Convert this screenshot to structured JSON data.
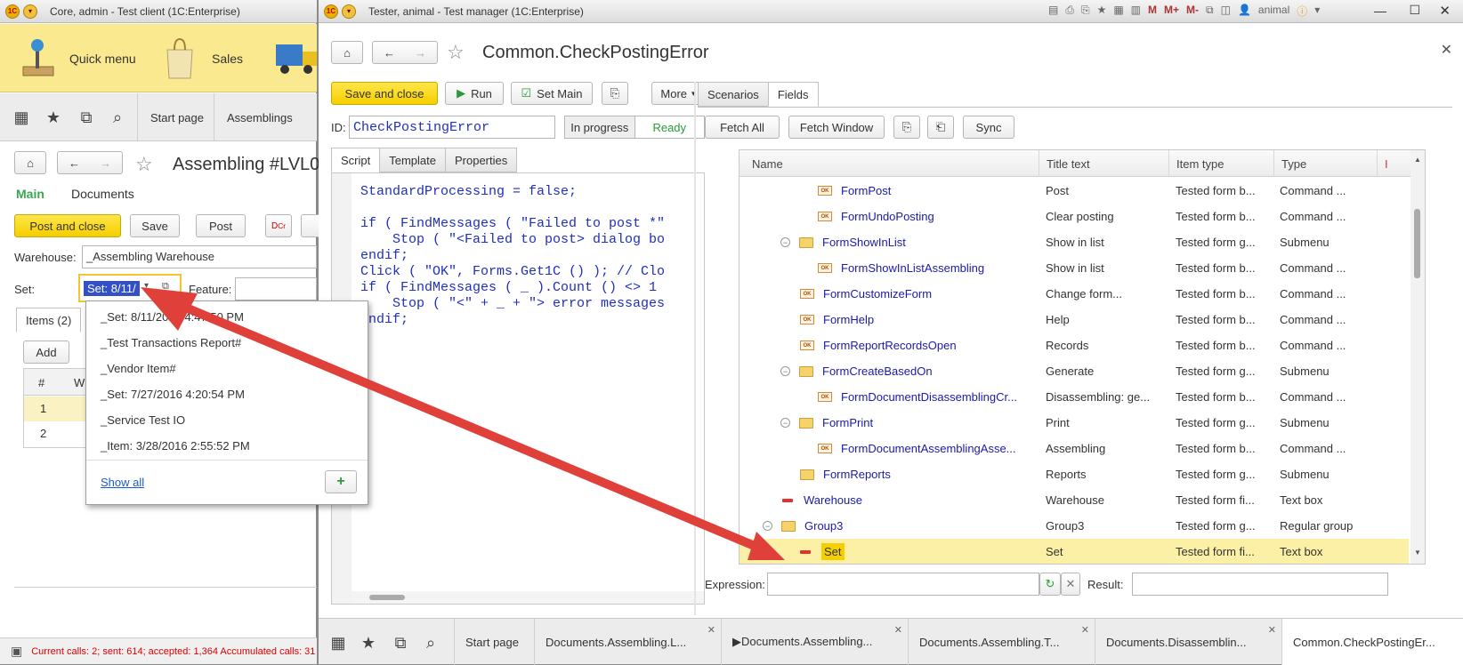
{
  "left_window": {
    "title": "Core, admin - Test client (1C:Enterprise)",
    "sections": [
      "Quick menu",
      "Sales"
    ],
    "nav_tabs": [
      "Start page",
      "Assemblings"
    ],
    "doc_title": "Assembling #LVL0",
    "subtabs": [
      "Main",
      "Documents"
    ],
    "buttons": {
      "post_close": "Post and close",
      "save": "Save",
      "post": "Post"
    },
    "warehouse_label": "Warehouse:",
    "warehouse_value": "_Assembling Warehouse",
    "set_label": "Set:",
    "set_value": "Set: 8/11/",
    "feature_label": "Feature:",
    "items_tab": "Items (2)",
    "add_button": "Add",
    "table_header": [
      "#",
      "W"
    ],
    "table_rows": [
      "1",
      "2"
    ],
    "status_text": "Current calls: 2; sent: 614; accepted: 1,364   Accumulated calls: 31"
  },
  "dropdown": {
    "items": [
      "_Set: 8/11/2016 4:47:50 PM",
      "_Test Transactions Report#",
      "_Vendor Item#",
      "_Set: 7/27/2016 4:20:54 PM",
      "_Service Test IO",
      "_Item: 3/28/2016 2:55:52 PM"
    ],
    "show_all": "Show all",
    "add_symbol": "+"
  },
  "right_window": {
    "title": "Tester, animal - Test manager (1C:Enterprise)",
    "user": "animal",
    "toolbar_marks": [
      "M",
      "M+",
      "M-"
    ],
    "doc_title": "Common.CheckPostingError",
    "buttons": {
      "save_close": "Save and close",
      "run": "Run",
      "set_main": "Set Main",
      "more": "More"
    },
    "id_label": "ID:",
    "id_value": "CheckPostingError",
    "status_in_progress": "In progress",
    "status_ready": "Ready",
    "script_tabs": [
      "Script",
      "Template",
      "Properties"
    ],
    "code_lines": [
      "StandardProcessing = false;",
      "",
      "if ( FindMessages ( \"Failed to post *\"",
      "    Stop ( \"<Failed to post> dialog bo",
      "endif;",
      "Click ( \"OK\", Forms.Get1C () ); // Clo",
      "if ( FindMessages ( _ ).Count () <> 1",
      "    Stop ( \"<\" + _ + \"> error messages",
      "endif;"
    ],
    "right_tabs": [
      "Scenarios",
      "Fields"
    ],
    "field_buttons": {
      "fetch_all": "Fetch All",
      "fetch_window": "Fetch Window",
      "sync": "Sync"
    },
    "columns": [
      "Name",
      "Title text",
      "Item type",
      "Type"
    ],
    "rows": [
      {
        "name": "FormPost",
        "title": "Post",
        "itemtype": "Tested form b...",
        "type": "Command ...",
        "icon": "ok",
        "level": 2,
        "expander": false
      },
      {
        "name": "FormUndoPosting",
        "title": "Clear posting",
        "itemtype": "Tested form b...",
        "type": "Command ...",
        "icon": "ok",
        "level": 2,
        "expander": false
      },
      {
        "name": "FormShowInList",
        "title": "Show in list",
        "itemtype": "Tested form g...",
        "type": "Submenu",
        "icon": "folder",
        "level": 1,
        "expander": true
      },
      {
        "name": "FormShowInListAssembling",
        "title": "Show in list",
        "itemtype": "Tested form b...",
        "type": "Command ...",
        "icon": "ok",
        "level": 2,
        "expander": false
      },
      {
        "name": "FormCustomizeForm",
        "title": "Change form...",
        "itemtype": "Tested form b...",
        "type": "Command ...",
        "icon": "ok",
        "level": 1,
        "expander": false
      },
      {
        "name": "FormHelp",
        "title": "Help",
        "itemtype": "Tested form b...",
        "type": "Command ...",
        "icon": "ok",
        "level": 1,
        "expander": false
      },
      {
        "name": "FormReportRecordsOpen",
        "title": "Records",
        "itemtype": "Tested form b...",
        "type": "Command ...",
        "icon": "ok",
        "level": 1,
        "expander": false
      },
      {
        "name": "FormCreateBasedOn",
        "title": "Generate",
        "itemtype": "Tested form g...",
        "type": "Submenu",
        "icon": "folder",
        "level": 1,
        "expander": true
      },
      {
        "name": "FormDocumentDisassemblingCr...",
        "title": "Disassembling: ge...",
        "itemtype": "Tested form b...",
        "type": "Command ...",
        "icon": "ok",
        "level": 2,
        "expander": false
      },
      {
        "name": "FormPrint",
        "title": "Print",
        "itemtype": "Tested form g...",
        "type": "Submenu",
        "icon": "folder",
        "level": 1,
        "expander": true
      },
      {
        "name": "FormDocumentAssemblingAsse...",
        "title": "Assembling",
        "itemtype": "Tested form b...",
        "type": "Command ...",
        "icon": "ok",
        "level": 2,
        "expander": false
      },
      {
        "name": "FormReports",
        "title": "Reports",
        "itemtype": "Tested form g...",
        "type": "Submenu",
        "icon": "folder",
        "level": 1,
        "expander": false
      },
      {
        "name": "Warehouse",
        "title": "Warehouse",
        "itemtype": "Tested form fi...",
        "type": "Text box",
        "icon": "minus",
        "level": 0,
        "expander": false
      },
      {
        "name": "Group3",
        "title": "Group3",
        "itemtype": "Tested form g...",
        "type": "Regular group",
        "icon": "folder",
        "level": 0,
        "expander": true
      },
      {
        "name": "Set",
        "title": "Set",
        "itemtype": "Tested form fi...",
        "type": "Text box",
        "icon": "minus",
        "level": 1,
        "expander": false,
        "selected": true
      }
    ],
    "expression_label": "Expression:",
    "result_label": "Result:",
    "bottom_tabs": [
      "Start page",
      "Documents.Assembling.L...",
      "▶Documents.Assembling...",
      "Documents.Assembling.T...",
      "Documents.Disassemblin...",
      "Common.CheckPostingEr..."
    ]
  },
  "colors": {
    "accent_yellow": "#f5cf00",
    "section_bg": "#fbe98f",
    "link_blue": "#1a1aaa",
    "arrow_red": "#e0403a",
    "selected_row": "#fbf0a6"
  }
}
